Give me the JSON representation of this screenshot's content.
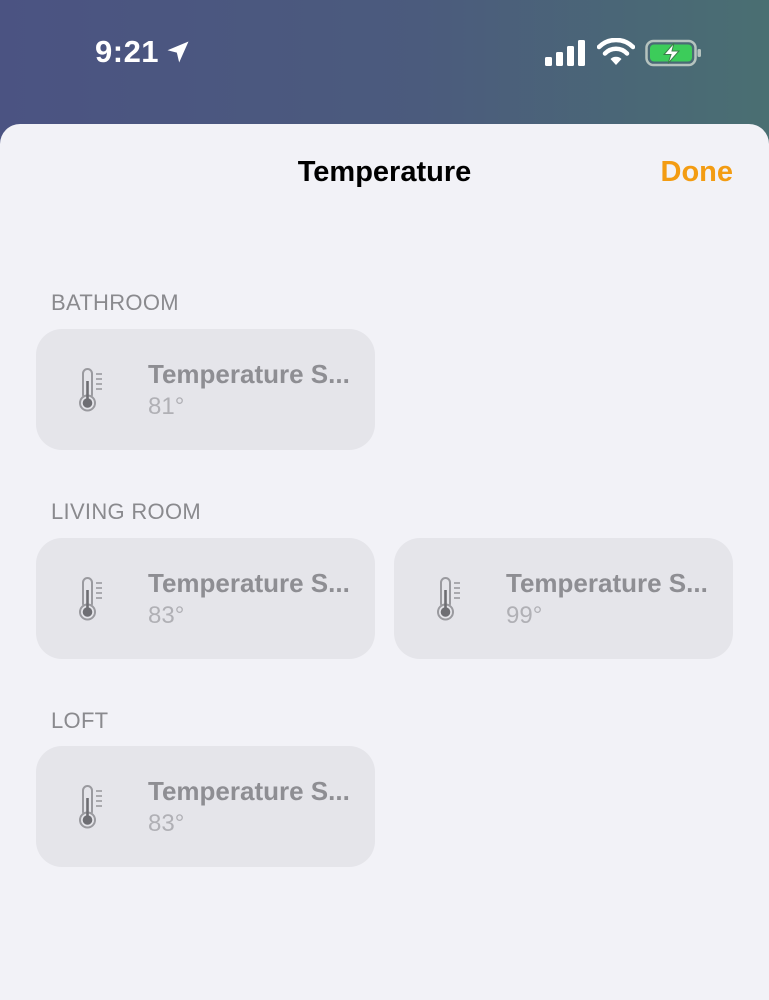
{
  "status_bar": {
    "time": "9:21"
  },
  "sheet": {
    "title": "Temperature",
    "done_label": "Done",
    "accent_color": "#f39c12"
  },
  "sections": [
    {
      "label": "BATHROOM",
      "accessories": [
        {
          "name": "Temperature S...",
          "value": "81°",
          "icon": "thermometer-icon"
        }
      ]
    },
    {
      "label": "LIVING ROOM",
      "accessories": [
        {
          "name": "Temperature S...",
          "value": "83°",
          "icon": "thermometer-icon"
        },
        {
          "name": "Temperature S...",
          "value": "99°",
          "icon": "thermometer-icon"
        }
      ]
    },
    {
      "label": "LOFT",
      "accessories": [
        {
          "name": "Temperature S...",
          "value": "83°",
          "icon": "thermometer-icon"
        }
      ]
    }
  ]
}
